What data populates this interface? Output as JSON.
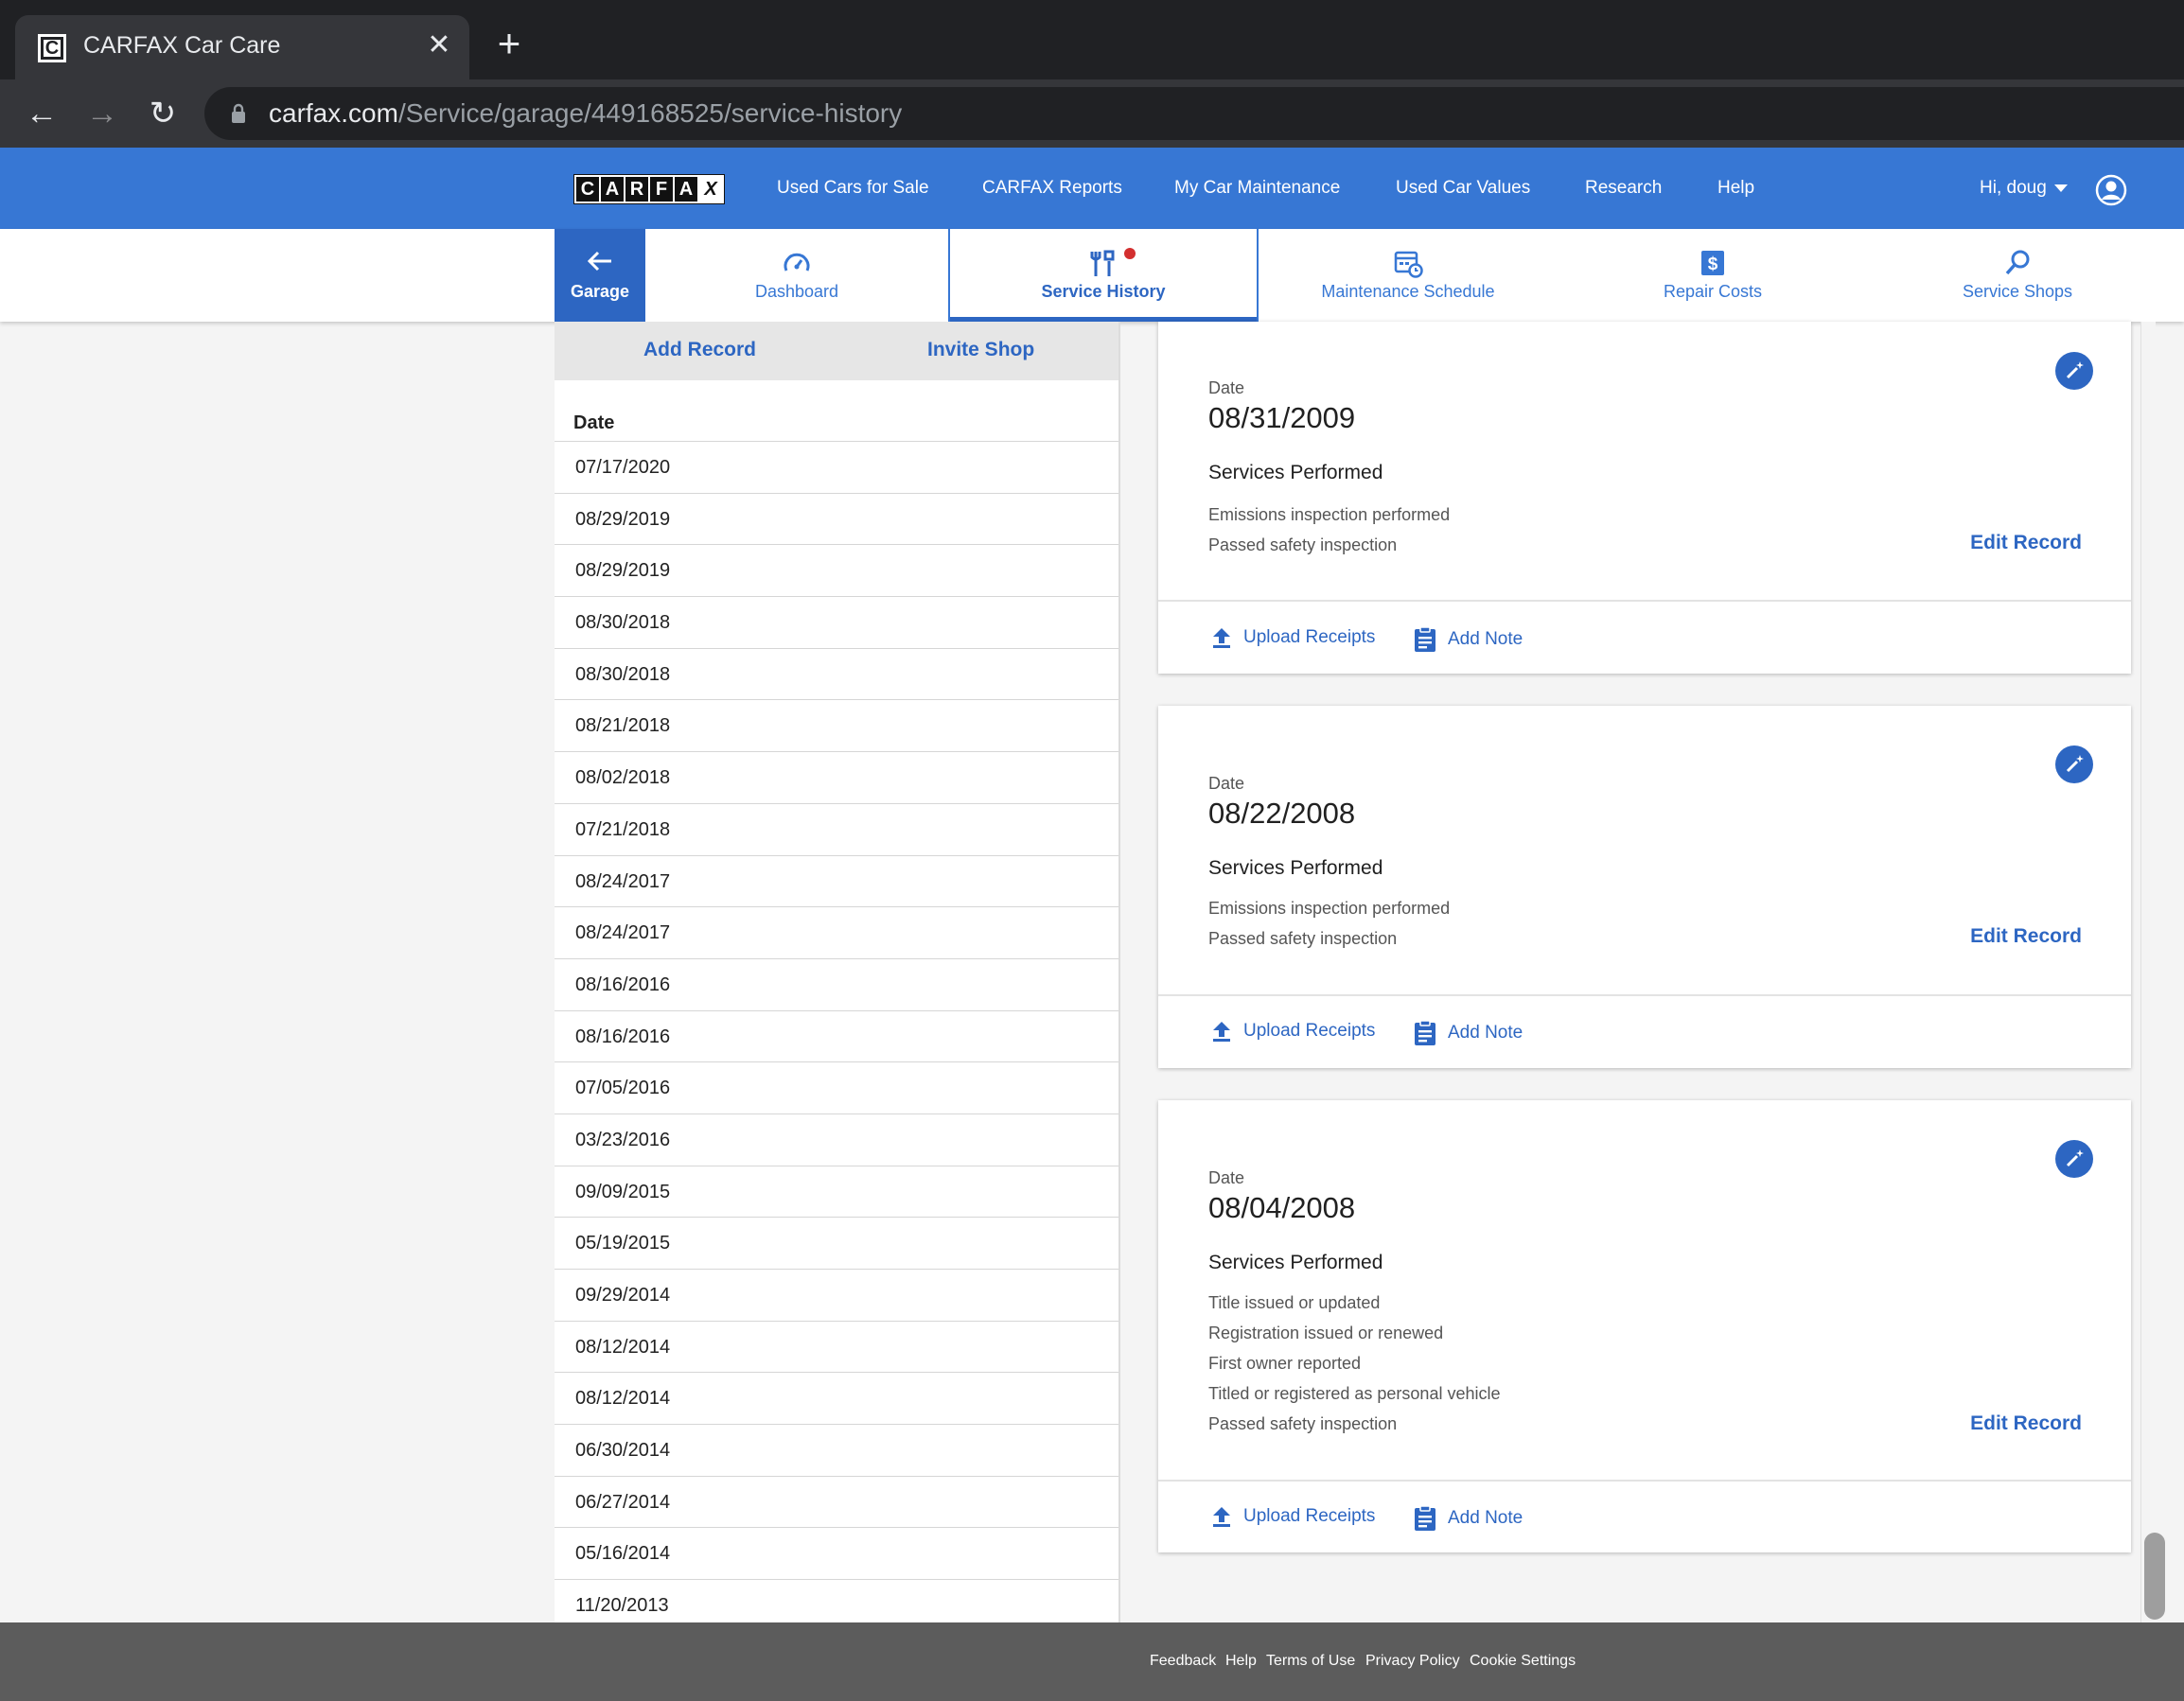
{
  "browser": {
    "tab_title": "CARFAX Car Care",
    "url_host": "carfax.com",
    "url_path": "/Service/garage/449168525/service-history"
  },
  "header": {
    "logo_letters": [
      "C",
      "A",
      "R",
      "F",
      "A",
      "X"
    ],
    "links": [
      "Used Cars for Sale",
      "CARFAX Reports",
      "My Car Maintenance",
      "Used Car Values",
      "Research",
      "Help"
    ],
    "user_greeting": "Hi, doug"
  },
  "subnav": {
    "garage_label": "Garage",
    "tabs": [
      {
        "label": "Dashboard",
        "icon": "speedometer-icon"
      },
      {
        "label": "Service History",
        "icon": "tools-icon",
        "active": true,
        "has_notification": true
      },
      {
        "label": "Maintenance Schedule",
        "icon": "calendar-clock-icon"
      },
      {
        "label": "Repair Costs",
        "icon": "dollar-icon"
      },
      {
        "label": "Service Shops",
        "icon": "search-icon"
      }
    ]
  },
  "left_panel": {
    "add_record": "Add Record",
    "invite_shop": "Invite Shop",
    "date_header": "Date",
    "dates": [
      "07/17/2020",
      "08/29/2019",
      "08/29/2019",
      "08/30/2018",
      "08/30/2018",
      "08/21/2018",
      "08/02/2018",
      "07/21/2018",
      "08/24/2017",
      "08/24/2017",
      "08/16/2016",
      "08/16/2016",
      "07/05/2016",
      "03/23/2016",
      "09/09/2015",
      "05/19/2015",
      "09/29/2014",
      "08/12/2014",
      "08/12/2014",
      "06/30/2014",
      "06/27/2014",
      "05/16/2014",
      "11/20/2013"
    ]
  },
  "cards": [
    {
      "date_label": "Date",
      "date": "08/31/2009",
      "services_title": "Services Performed",
      "services": [
        "Emissions inspection performed",
        "Passed safety inspection"
      ],
      "edit_record": "Edit Record",
      "upload_receipts": "Upload Receipts",
      "add_note": "Add Note"
    },
    {
      "date_label": "Date",
      "date": "08/22/2008",
      "services_title": "Services Performed",
      "services": [
        "Emissions inspection performed",
        "Passed safety inspection"
      ],
      "edit_record": "Edit Record",
      "upload_receipts": "Upload Receipts",
      "add_note": "Add Note"
    },
    {
      "date_label": "Date",
      "date": "08/04/2008",
      "services_title": "Services Performed",
      "services": [
        "Title issued or updated",
        "Registration issued or renewed",
        "First owner reported",
        "Titled or registered as personal vehicle",
        "Passed safety inspection"
      ],
      "edit_record": "Edit Record",
      "upload_receipts": "Upload Receipts",
      "add_note": "Add Note"
    }
  ],
  "footer": {
    "links": [
      "Feedback",
      "Help",
      "Terms of Use",
      "Privacy Policy",
      "Cookie Settings"
    ]
  },
  "colors": {
    "brand_blue": "#3777d4",
    "accent_blue": "#2d66c2",
    "notification_red": "#d32f2f",
    "footer_gray": "#5c5c5c"
  }
}
